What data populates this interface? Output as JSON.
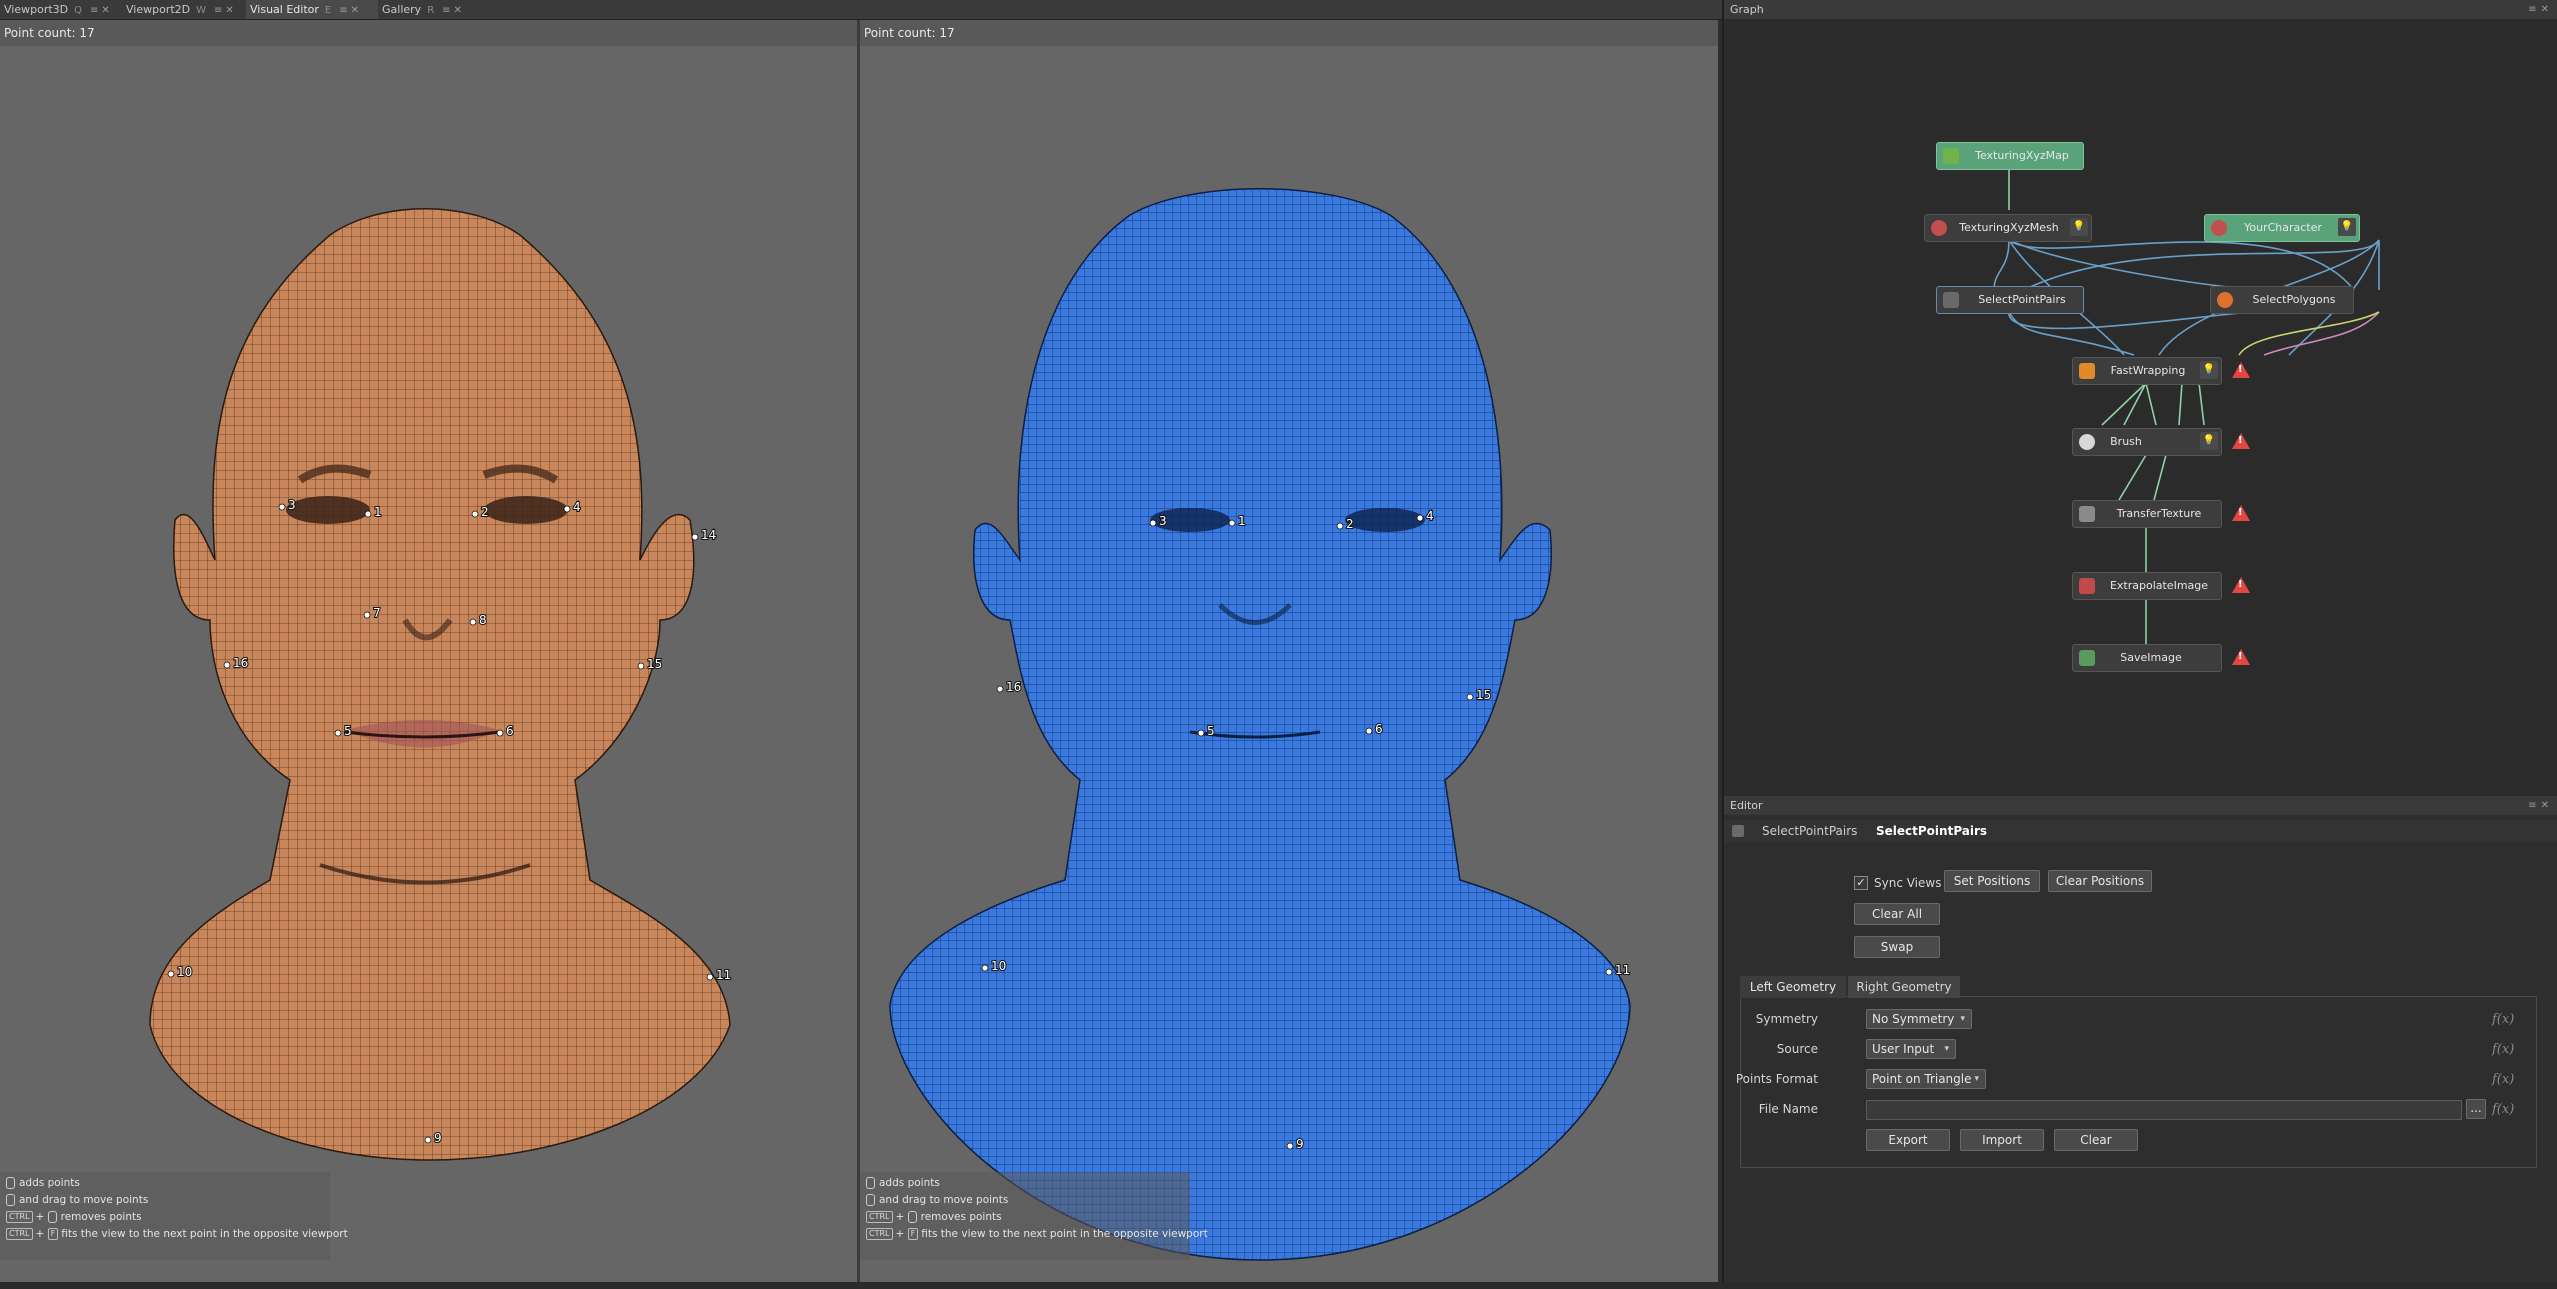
{
  "tabs": [
    {
      "label": "Viewport3D",
      "shortcut": "Q"
    },
    {
      "label": "Viewport2D",
      "shortcut": "W"
    },
    {
      "label": "Visual Editor",
      "shortcut": "E"
    },
    {
      "label": "Gallery",
      "shortcut": "R"
    }
  ],
  "viewport_left": {
    "point_count": "Point count: 17",
    "mesh_color": "#c8865a",
    "points": [
      {
        "label": "1"
      },
      {
        "label": "2"
      },
      {
        "label": "3"
      },
      {
        "label": "4"
      },
      {
        "label": "5"
      },
      {
        "label": "6"
      },
      {
        "label": "7"
      },
      {
        "label": "8"
      },
      {
        "label": "9"
      },
      {
        "label": "10"
      },
      {
        "label": "11"
      },
      {
        "label": "14"
      },
      {
        "label": "15"
      },
      {
        "label": "16"
      }
    ]
  },
  "viewport_right": {
    "point_count": "Point count: 17",
    "mesh_color": "#3a7ae0",
    "points": [
      {
        "label": "1"
      },
      {
        "label": "2"
      },
      {
        "label": "3"
      },
      {
        "label": "4"
      },
      {
        "label": "5"
      },
      {
        "label": "6"
      },
      {
        "label": "9"
      },
      {
        "label": "10"
      },
      {
        "label": "11"
      },
      {
        "label": "15"
      },
      {
        "label": "16"
      }
    ]
  },
  "hints": [
    {
      "key": "",
      "text": "adds points"
    },
    {
      "key": "",
      "text": "and drag to move points"
    },
    {
      "key": "CTRL",
      "text": "removes points"
    },
    {
      "key": "CTRL",
      "text": "fits the view to the next point in the opposite viewport"
    }
  ],
  "graph": {
    "title": "Graph",
    "nodes": [
      {
        "label": "TexturingXyzMap",
        "icon_color": "#6fb34a"
      },
      {
        "label": "TexturingXyzMesh",
        "icon_color": "#c0504d"
      },
      {
        "label": "YourCharacter",
        "icon_color": "#c0504d"
      },
      {
        "label": "SelectPointPairs",
        "icon_color": "#9aa0a6"
      },
      {
        "label": "SelectPolygons",
        "icon_color": "#e07030"
      },
      {
        "label": "FastWrapping",
        "icon_color": "#e08a2a"
      },
      {
        "label": "Brush",
        "icon_color": "#d8d8d8"
      },
      {
        "label": "TransferTexture",
        "icon_color": "#8a8a8a"
      },
      {
        "label": "ExtrapolateImage",
        "icon_color": "#c04a4a"
      },
      {
        "label": "SaveImage",
        "icon_color": "#5a9a5a"
      }
    ],
    "warning_color": "#e2463f"
  },
  "editor": {
    "title": "Editor",
    "node_type": "SelectPointPairs",
    "node_name": "SelectPointPairs",
    "sync_views_label": "Sync Views",
    "sync_views_checked": true,
    "set_positions": "Set Positions",
    "clear_positions": "Clear Positions",
    "clear_all": "Clear All",
    "swap": "Swap",
    "tab_left": "Left Geometry",
    "tab_right": "Right Geometry",
    "symmetry_label": "Symmetry",
    "symmetry_value": "No Symmetry",
    "source_label": "Source",
    "source_value": "User Input",
    "points_format_label": "Points Format",
    "points_format_value": "Point on Triangle",
    "file_name_label": "File Name",
    "file_name_value": "",
    "browse": "...",
    "export": "Export",
    "import": "Import",
    "clear": "Clear",
    "fx": "f(x)"
  }
}
